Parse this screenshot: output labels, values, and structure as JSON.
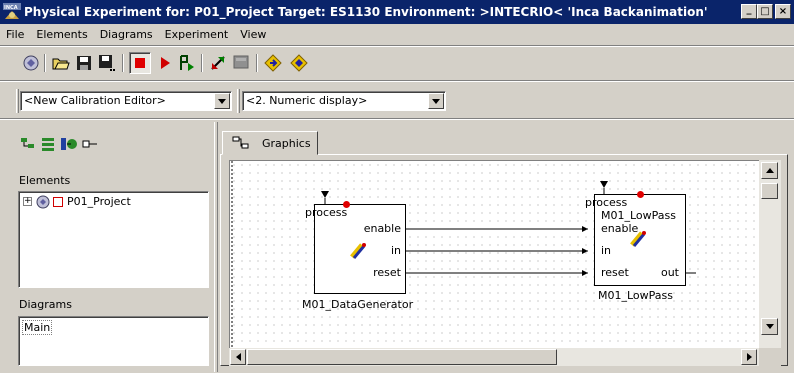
{
  "window": {
    "title": "Physical Experiment for: P01_Project  Target: ES1130  Environment: >INTECRIO<  'Inca Backanimation'",
    "icon_badge": "INCA",
    "minimize": "_",
    "maximize": "□",
    "close": "×"
  },
  "menu": [
    "File",
    "Elements",
    "Diagrams",
    "Experiment",
    "View"
  ],
  "toolbar": {
    "icons": [
      "experiment-icon",
      "open-folder-icon",
      "save-icon",
      "save-as-icon",
      "stop-icon",
      "play-icon",
      "step-icon",
      "switch-icon",
      "monitor-icon",
      "record-icon",
      "record-options-icon"
    ],
    "colors": {
      "stop": "#e00000",
      "play": "#d00000",
      "diamond": "#e8c000"
    }
  },
  "editors": {
    "calibration": "<New Calibration Editor>",
    "display": "<2. Numeric display>"
  },
  "left_panel": {
    "elements_label": "Elements",
    "tree": [
      {
        "label": "P01_Project",
        "expander": "⊞"
      }
    ],
    "diagrams_label": "Diagrams",
    "diagrams": [
      "Main"
    ]
  },
  "graphics": {
    "tab_label": "Graphics",
    "blocks": [
      {
        "name": "M01_DataGenerator",
        "trigger": "process",
        "outputs": [
          "enable",
          "in",
          "reset"
        ]
      },
      {
        "name": "M01_LowPass",
        "trigger": "process",
        "title": "M01_LowPass",
        "inputs": [
          "enable",
          "in",
          "reset"
        ],
        "outputs": [
          "out"
        ]
      }
    ]
  }
}
